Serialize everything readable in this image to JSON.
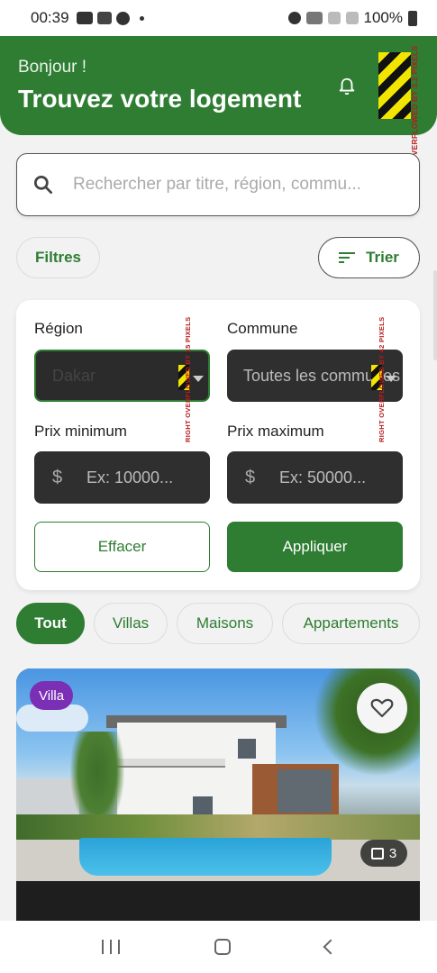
{
  "status_bar": {
    "time": "00:39",
    "battery": "100%"
  },
  "header": {
    "greeting": "Bonjour !",
    "title": "Trouvez votre logement",
    "overflow_warning": "RIGHT OVERFLOWED BY 3.2 PIXELS"
  },
  "search": {
    "placeholder": "Rechercher par titre, région, commu..."
  },
  "filter_row": {
    "filters_label": "Filtres",
    "sort_label": "Trier"
  },
  "filter_card": {
    "region_label": "Région",
    "region_value": "Dakar",
    "region_overflow": "RIGHT OVERFLOWED BY 15 PIXELS",
    "commune_label": "Commune",
    "commune_value": "Toutes les communes",
    "commune_overflow": "RIGHT OVERFLOWED BY 42 PIXELS",
    "price_min_label": "Prix minimum",
    "price_min_placeholder": "Ex: 10000...",
    "price_max_label": "Prix maximum",
    "price_max_placeholder": "Ex: 50000...",
    "currency_symbol": "$",
    "clear_label": "Effacer",
    "apply_label": "Appliquer"
  },
  "categories": [
    {
      "label": "Tout",
      "active": true
    },
    {
      "label": "Villas",
      "active": false
    },
    {
      "label": "Maisons",
      "active": false
    },
    {
      "label": "Appartements",
      "active": false
    }
  ],
  "listing": {
    "type_badge": "Villa",
    "photo_count": "3"
  },
  "colors": {
    "primary": "#2e7d32",
    "badge_purple": "#7b2fb5",
    "field_dark": "#2f2f2f"
  },
  "icons": [
    "search-icon",
    "bell-icon",
    "sort-icon",
    "heart-icon",
    "image-icon",
    "dropdown-caret-icon"
  ]
}
